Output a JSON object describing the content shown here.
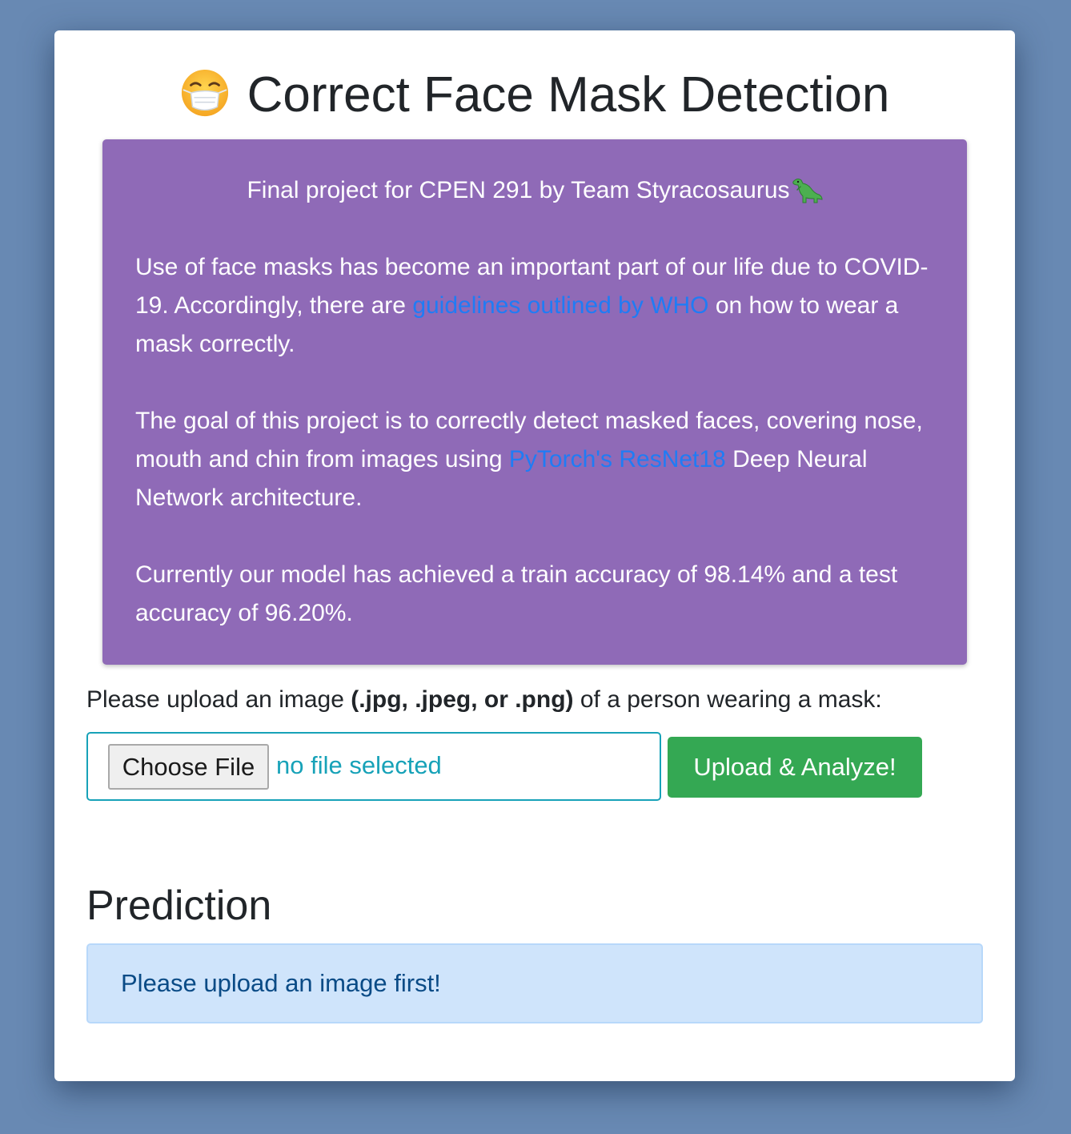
{
  "header": {
    "title": "Correct Face Mask Detection"
  },
  "info": {
    "subtitle": "Final project for CPEN 291 by Team Styracosaurus",
    "para1_part1": "Use of face masks has become an important part of our life due to COVID-19. Accordingly, there are ",
    "para1_link": "guidelines outlined by WHO",
    "para1_part2": " on how to wear a mask correctly.",
    "para2_part1": "The goal of this project is to correctly detect masked faces, covering nose, mouth and chin from images using ",
    "para2_link": "PyTorch's ResNet18",
    "para2_part2": " Deep Neural Network architecture.",
    "para3": "Currently our model has achieved a train accuracy of 98.14% and a test accuracy of 96.20%."
  },
  "upload": {
    "label_prefix": "Please upload an image ",
    "label_bold": "(.jpg, .jpeg, or .png)",
    "label_suffix": " of a person wearing a mask:",
    "choose_file_label": "Choose File",
    "file_status": "no file selected",
    "submit_label": "Upload & Analyze!"
  },
  "prediction": {
    "heading": "Prediction",
    "message": "Please upload an image first!"
  },
  "icons": {
    "title_icon": "face-with-medical-mask-icon",
    "team_icon": "dinosaur-icon"
  },
  "colors": {
    "background": "#6889b3",
    "info_box": "#8f6ab7",
    "link": "#1f7cf5",
    "accent_info": "#17a2b8",
    "success": "#34a853",
    "alert_bg": "#cfe4fb",
    "alert_text": "#0a4b86"
  }
}
